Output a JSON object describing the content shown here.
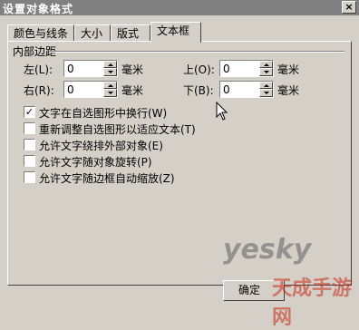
{
  "window": {
    "title": "设置对象格式",
    "close_icon": "×"
  },
  "tabs": [
    {
      "label": "颜色与线条",
      "active": false
    },
    {
      "label": "大小",
      "active": false
    },
    {
      "label": "版式",
      "active": false
    },
    {
      "label": "文本框",
      "active": true
    }
  ],
  "margins": {
    "group_label": "内部边距",
    "left": {
      "label": "左(L):",
      "value": "0",
      "unit": "毫米"
    },
    "top": {
      "label": "上(O):",
      "value": "0",
      "unit": "毫米"
    },
    "right": {
      "label": "右(R):",
      "value": "0",
      "unit": "毫米"
    },
    "bottom": {
      "label": "下(B):",
      "value": "0",
      "unit": "毫米"
    }
  },
  "options": [
    {
      "label": "文字在自选图形中换行(W)",
      "checked": true
    },
    {
      "label": "重新调整自选图形以适应文本(T)",
      "checked": false
    },
    {
      "label": "允许文字绕排外部对象(E)",
      "checked": false
    },
    {
      "label": "允许文字随对象旋转(P)",
      "checked": false
    },
    {
      "label": "允许文字随边框自动缩放(Z)",
      "checked": false
    }
  ],
  "buttons": {
    "ok_label": "确定"
  },
  "watermarks": {
    "brand": "yesky",
    "site": "天成手游网"
  }
}
